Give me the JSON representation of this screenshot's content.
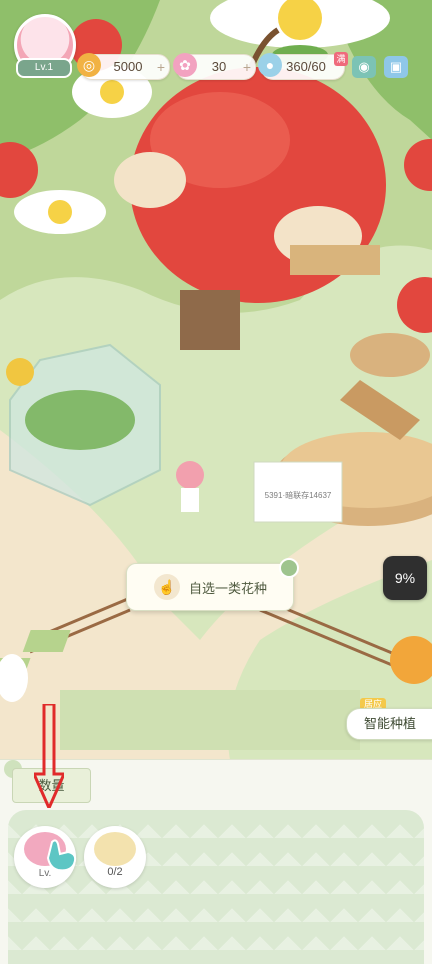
{
  "hud": {
    "level_label": "Lv.1",
    "coins": "5000",
    "petals": "30",
    "water": "360/60",
    "water_full_badge": "满"
  },
  "scene": {
    "garden_sign": "5391·暗联存14637"
  },
  "tooltip": {
    "text": "自选一类花种"
  },
  "progress": {
    "percent_label": "9%"
  },
  "smart_plant": {
    "tag": "居应",
    "label": "智能种植"
  },
  "bottom": {
    "tab_label": "数量",
    "slots": [
      {
        "label": "Lv.",
        "count": ""
      },
      {
        "label": "",
        "count": "0/2"
      }
    ]
  },
  "colors": {
    "accent_green": "#7aa58c",
    "apple_red": "#e2473e",
    "path_beige": "#f3e6cc",
    "panel_bg": "#f6f7f0"
  }
}
